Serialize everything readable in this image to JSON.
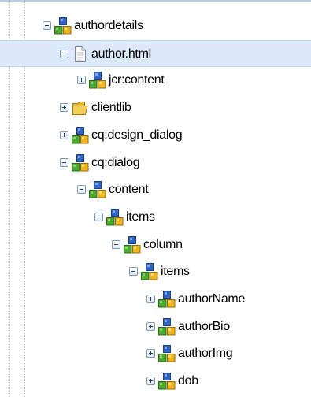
{
  "tree": {
    "nodes": [
      {
        "label": "authordetails",
        "depth": 0,
        "expanded": true,
        "icon": "node-cubes-icon",
        "selected": false
      },
      {
        "label": "author.html",
        "depth": 1,
        "expanded": true,
        "icon": "file-icon",
        "selected": true
      },
      {
        "label": "jcr:content",
        "depth": 2,
        "expanded": false,
        "icon": "node-cubes-icon",
        "selected": false
      },
      {
        "label": "clientlib",
        "depth": 1,
        "expanded": false,
        "icon": "folder-icon",
        "selected": false
      },
      {
        "label": "cq:design_dialog",
        "depth": 1,
        "expanded": false,
        "icon": "node-cubes-icon",
        "selected": false
      },
      {
        "label": "cq:dialog",
        "depth": 1,
        "expanded": true,
        "icon": "node-cubes-icon",
        "selected": false
      },
      {
        "label": "content",
        "depth": 2,
        "expanded": true,
        "icon": "node-cubes-icon",
        "selected": false
      },
      {
        "label": "items",
        "depth": 3,
        "expanded": true,
        "icon": "node-cubes-icon",
        "selected": false
      },
      {
        "label": "column",
        "depth": 4,
        "expanded": true,
        "icon": "node-cubes-icon",
        "selected": false
      },
      {
        "label": "items",
        "depth": 5,
        "expanded": true,
        "icon": "node-cubes-icon",
        "selected": false
      },
      {
        "label": "authorName",
        "depth": 6,
        "expanded": false,
        "icon": "node-cubes-icon",
        "selected": false
      },
      {
        "label": "authorBio",
        "depth": 6,
        "expanded": false,
        "icon": "node-cubes-icon",
        "selected": false
      },
      {
        "label": "authorImg",
        "depth": 6,
        "expanded": false,
        "icon": "node-cubes-icon",
        "selected": false
      },
      {
        "label": "dob",
        "depth": 6,
        "expanded": false,
        "icon": "node-cubes-icon",
        "selected": false
      }
    ]
  },
  "colors": {
    "selection": "#dce9f8",
    "cube_blue": "#2f64c7",
    "cube_green": "#4caa2f",
    "cube_yellow": "#f0b51c",
    "folder": "#f3cf55"
  }
}
